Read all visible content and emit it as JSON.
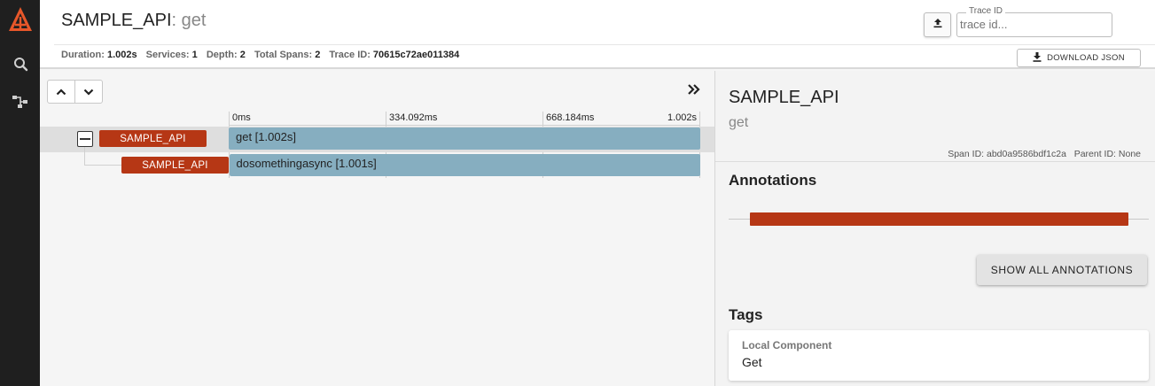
{
  "nav": {
    "logo_icon": "zipkin-logo-icon",
    "items": [
      {
        "icon": "search-icon"
      },
      {
        "icon": "dependencies-icon"
      }
    ]
  },
  "header": {
    "service_name": "SAMPLE_API",
    "separator": ": ",
    "span_name": "get",
    "trace_id_label": "Trace ID",
    "trace_id_placeholder": "trace id...",
    "download_label": "DOWNLOAD JSON",
    "summary": [
      {
        "key": "Duration:",
        "value": "1.002s"
      },
      {
        "key": "Services:",
        "value": "1"
      },
      {
        "key": "Depth:",
        "value": "2"
      },
      {
        "key": "Total Spans:",
        "value": "2"
      },
      {
        "key": "Trace ID:",
        "value": "70615c72ae011384"
      }
    ]
  },
  "timeline": {
    "ticks": [
      "0ms",
      "334.092ms",
      "668.184ms",
      "1.002s"
    ],
    "spans": [
      {
        "service": "SAMPLE_API",
        "label": "get [1.002s]",
        "start": 0,
        "duration": 1.002
      },
      {
        "service": "SAMPLE_API",
        "label": "dosomethingasync [1.001s]",
        "start": 0.001,
        "duration": 1.001
      }
    ]
  },
  "detail": {
    "service_name": "SAMPLE_API",
    "span_name": "get",
    "span_id_label": "Span ID:",
    "span_id": "abd0a9586bdf1c2a",
    "parent_id_label": "Parent ID:",
    "parent_id": "None",
    "annotations_heading": "Annotations",
    "show_all_label": "SHOW ALL ANNOTATIONS",
    "tags_heading": "Tags",
    "tags": [
      {
        "key": "Local Component",
        "value": "Get"
      }
    ]
  },
  "colors": {
    "service_tag": "#b63715",
    "span_bar": "#86aec0",
    "sidebar": "#1f1f1f",
    "logo": "#e8572a"
  }
}
